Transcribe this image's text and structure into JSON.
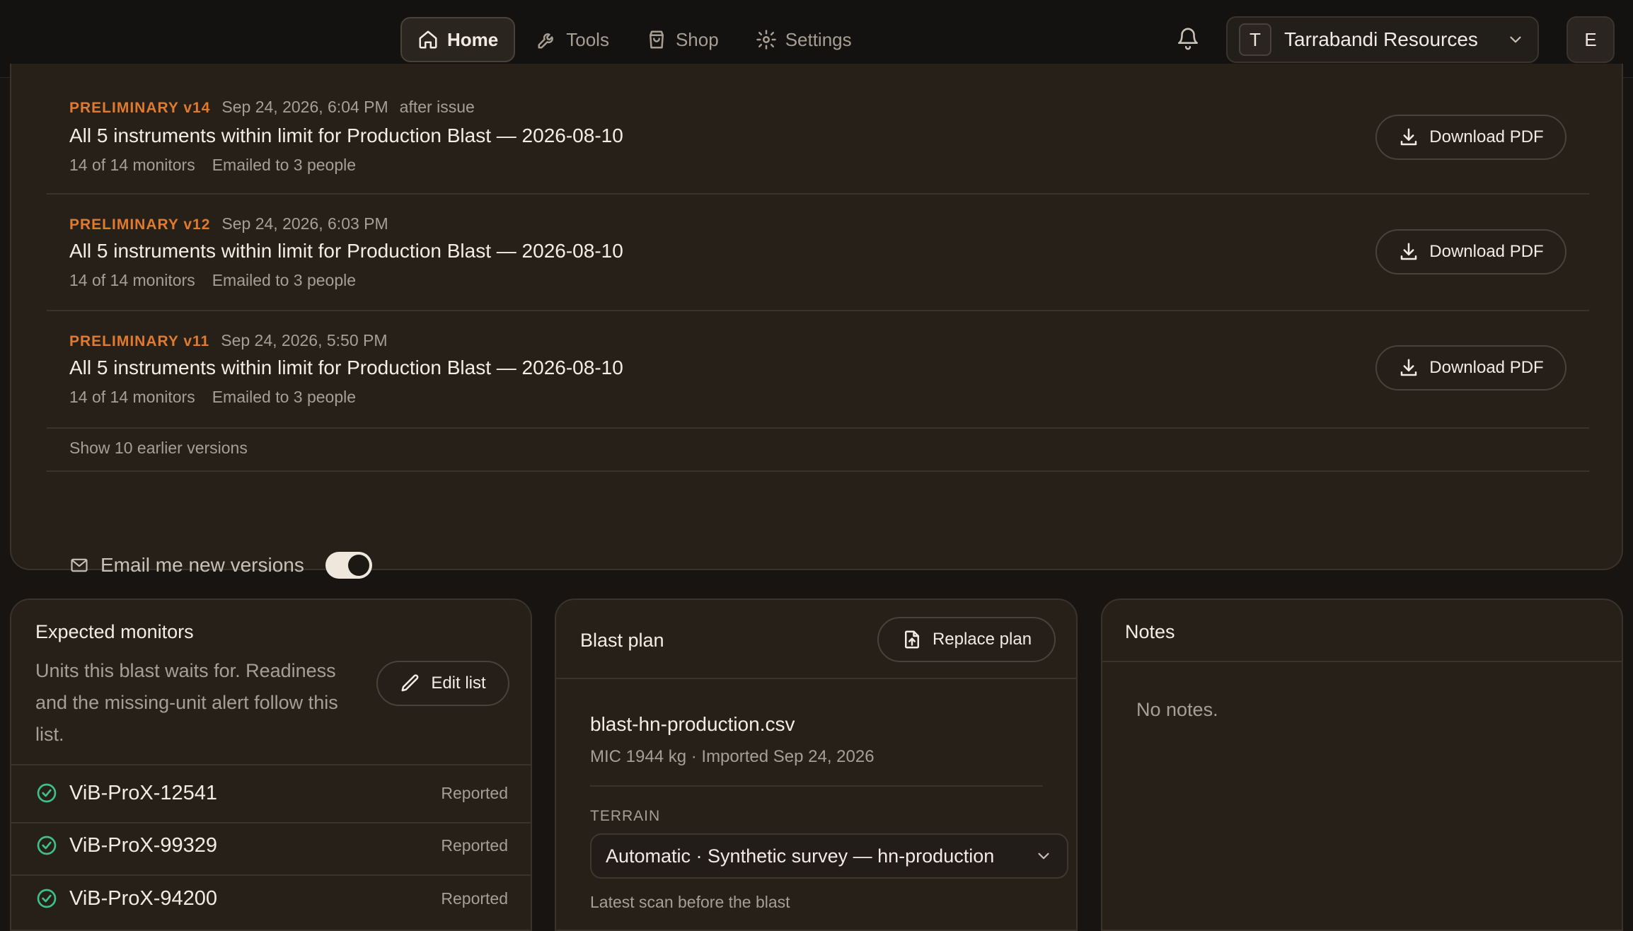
{
  "nav": {
    "items": [
      {
        "label": "Home",
        "icon": "home-icon",
        "active": true
      },
      {
        "label": "Tools",
        "icon": "wrench-icon",
        "active": false
      },
      {
        "label": "Shop",
        "icon": "shopping-bag-icon",
        "active": false
      },
      {
        "label": "Settings",
        "icon": "gear-icon",
        "active": false
      }
    ]
  },
  "header": {
    "org_initial": "T",
    "org_name": "Tarrabandi Resources",
    "user_initial": "E"
  },
  "versions": {
    "items": [
      {
        "tag": "PRELIMINARY v14",
        "timestamp": "Sep 24, 2026, 6:04 PM",
        "note": "after issue",
        "title": "All 5 instruments within limit for Production Blast — 2026-08-10",
        "monitors": "14 of 14 monitors",
        "emailed": "Emailed to 3 people",
        "button": "Download PDF"
      },
      {
        "tag": "PRELIMINARY v12",
        "timestamp": "Sep 24, 2026, 6:03 PM",
        "note": "",
        "title": "All 5 instruments within limit for Production Blast — 2026-08-10",
        "monitors": "14 of 14 monitors",
        "emailed": "Emailed to 3 people",
        "button": "Download PDF"
      },
      {
        "tag": "PRELIMINARY v11",
        "timestamp": "Sep 24, 2026, 5:50 PM",
        "note": "",
        "title": "All 5 instruments within limit for Production Blast — 2026-08-10",
        "monitors": "14 of 14 monitors",
        "emailed": "Emailed to 3 people",
        "button": "Download PDF"
      }
    ],
    "show_earlier": "Show 10 earlier versions",
    "email_toggle_label": "Email me new versions",
    "email_toggle_on": true
  },
  "monitors": {
    "title": "Expected monitors",
    "description": "Units this blast waits for. Readiness and the missing-unit alert follow this list.",
    "edit_button": "Edit list",
    "items": [
      {
        "name": "ViB-ProX-12541",
        "status": "Reported"
      },
      {
        "name": "ViB-ProX-99329",
        "status": "Reported"
      },
      {
        "name": "ViB-ProX-94200",
        "status": "Reported"
      }
    ]
  },
  "blast_plan": {
    "title": "Blast plan",
    "replace_button": "Replace plan",
    "file_name": "blast-hn-production.csv",
    "file_meta": "MIC 1944 kg · Imported Sep 24, 2026",
    "terrain_label": "TERRAIN",
    "terrain_value": "Automatic · Synthetic survey — hn-production",
    "terrain_help": "Latest scan before the blast"
  },
  "notes": {
    "title": "Notes",
    "empty": "No notes."
  },
  "colors": {
    "accent_orange": "#e07a2e",
    "success_green": "#3fbf8a",
    "background": "#171411",
    "card": "#262019"
  }
}
